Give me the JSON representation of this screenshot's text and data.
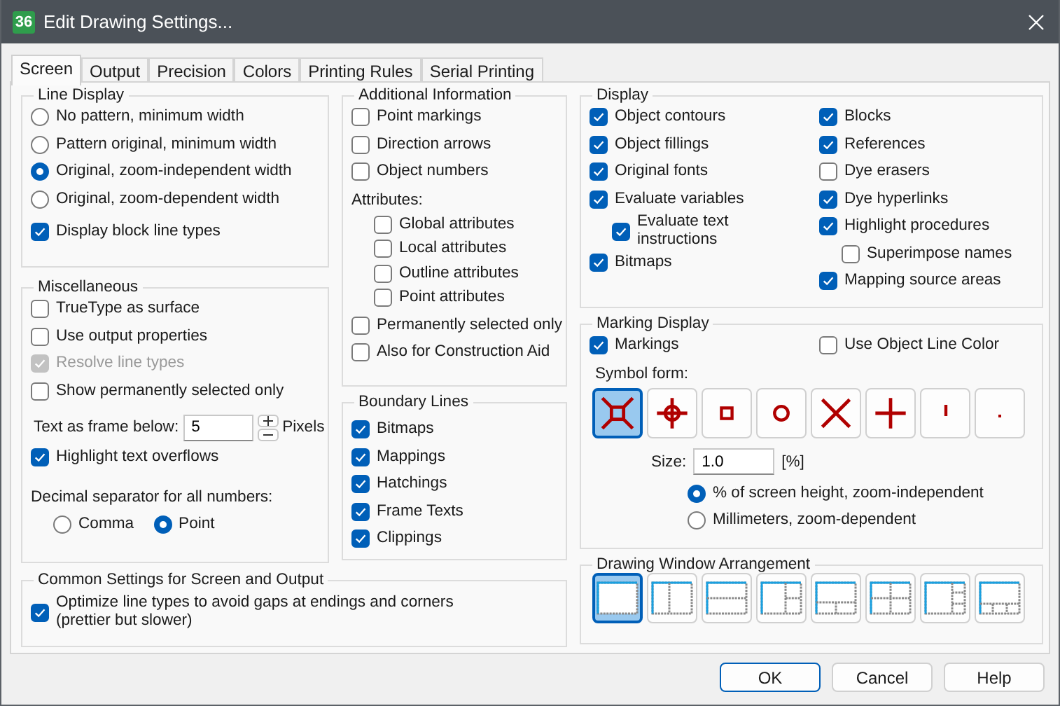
{
  "window": {
    "title": "Edit Drawing Settings...",
    "app_icon": "36"
  },
  "tabs": [
    {
      "label": "Screen",
      "selected": true
    },
    {
      "label": "Output",
      "selected": false
    },
    {
      "label": "Precision",
      "selected": false
    },
    {
      "label": "Colors",
      "selected": false
    },
    {
      "label": "Printing Rules",
      "selected": false
    },
    {
      "label": "Serial Printing",
      "selected": false
    }
  ],
  "line_display": {
    "title": "Line Display",
    "options": [
      {
        "label": "No pattern, minimum width",
        "selected": false
      },
      {
        "label": "Pattern original, minimum width",
        "selected": false
      },
      {
        "label": "Original, zoom-independent width",
        "selected": true
      },
      {
        "label": "Original, zoom-dependent width",
        "selected": false
      }
    ],
    "checkbox": {
      "label": "Display block line types",
      "checked": true
    }
  },
  "miscellaneous": {
    "title": "Miscellaneous",
    "checkboxes": [
      {
        "label": "TrueType as surface",
        "checked": false,
        "disabled": false
      },
      {
        "label": "Use output properties",
        "checked": false,
        "disabled": false
      },
      {
        "label": "Resolve line types",
        "checked": true,
        "disabled": true
      },
      {
        "label": "Show permanently selected only",
        "checked": false,
        "disabled": false
      }
    ],
    "text_frame": {
      "label": "Text as frame below:",
      "value": "5",
      "unit": "Pixels"
    },
    "highlight": {
      "label": "Highlight text overflows",
      "checked": true
    },
    "decimal": {
      "label": "Decimal separator for all numbers:",
      "options": [
        {
          "label": "Comma",
          "selected": false
        },
        {
          "label": "Point",
          "selected": true
        }
      ]
    }
  },
  "additional_information": {
    "title": "Additional Information",
    "items": [
      {
        "label": "Point markings",
        "checked": false
      },
      {
        "label": "Direction arrows",
        "checked": false
      },
      {
        "label": "Object numbers",
        "checked": false
      }
    ],
    "attributes_label": "Attributes:",
    "attributes": [
      {
        "label": "Global attributes",
        "checked": false
      },
      {
        "label": "Local attributes",
        "checked": false
      },
      {
        "label": "Outline attributes",
        "checked": false
      },
      {
        "label": "Point attributes",
        "checked": false
      }
    ],
    "more": [
      {
        "label": "Permanently selected only",
        "checked": false
      },
      {
        "label": "Also for Construction Aid",
        "checked": false
      }
    ]
  },
  "boundary_lines": {
    "title": "Boundary Lines",
    "items": [
      {
        "label": "Bitmaps",
        "checked": true
      },
      {
        "label": "Mappings",
        "checked": true
      },
      {
        "label": "Hatchings",
        "checked": true
      },
      {
        "label": "Frame Texts",
        "checked": true
      },
      {
        "label": "Clippings",
        "checked": true
      }
    ]
  },
  "common_settings": {
    "title": "Common Settings for Screen and Output",
    "items": [
      {
        "label": "Optimize line types to avoid gaps at endings and corners\n(prettier but slower)",
        "checked": true
      }
    ]
  },
  "display": {
    "title": "Display",
    "left": [
      {
        "label": "Object contours",
        "checked": true
      },
      {
        "label": "Object fillings",
        "checked": true
      },
      {
        "label": "Original fonts",
        "checked": true
      },
      {
        "label": "Evaluate variables",
        "checked": true,
        "children": [
          {
            "label": "Evaluate text\ninstructions",
            "checked": true
          }
        ]
      },
      {
        "label": "Bitmaps",
        "checked": true
      }
    ],
    "right": [
      {
        "label": "Blocks",
        "checked": true
      },
      {
        "label": "References",
        "checked": true
      },
      {
        "label": "Dye erasers",
        "checked": false
      },
      {
        "label": "Dye hyperlinks",
        "checked": true
      },
      {
        "label": "Highlight procedures",
        "checked": true,
        "children": [
          {
            "label": "Superimpose names",
            "checked": false
          }
        ]
      },
      {
        "label": "Mapping source areas",
        "checked": true
      }
    ]
  },
  "marking_display": {
    "title": "Marking Display",
    "markings": {
      "label": "Markings",
      "checked": true
    },
    "object_color": {
      "label": "Use Object Line Color",
      "checked": false
    },
    "symbol_label": "Symbol form:",
    "symbols": [
      {
        "kind": "crossbox",
        "selected": true
      },
      {
        "kind": "crosshair",
        "selected": false
      },
      {
        "kind": "square",
        "selected": false
      },
      {
        "kind": "circle",
        "selected": false
      },
      {
        "kind": "cross",
        "selected": false
      },
      {
        "kind": "plus",
        "selected": false
      },
      {
        "kind": "tick",
        "selected": false
      },
      {
        "kind": "dot",
        "selected": false
      }
    ],
    "size": {
      "label": "Size:",
      "value": "1.0",
      "unit": "[%]"
    },
    "units": [
      {
        "label": "% of screen height, zoom-independent",
        "selected": true
      },
      {
        "label": "Millimeters, zoom-dependent",
        "selected": false
      }
    ]
  },
  "arrangement": {
    "title": "Drawing Window Arrangement",
    "layouts": [
      {
        "kind": "single",
        "selected": true
      },
      {
        "kind": "columns",
        "selected": false
      },
      {
        "kind": "rows",
        "selected": false
      },
      {
        "kind": "left-main-2",
        "selected": false
      },
      {
        "kind": "top-main-2",
        "selected": false
      },
      {
        "kind": "quad",
        "selected": false
      },
      {
        "kind": "left-main-3",
        "selected": false
      },
      {
        "kind": "top-main-3",
        "selected": false
      }
    ]
  },
  "buttons": [
    {
      "label": "OK",
      "default": true
    },
    {
      "label": "Cancel",
      "default": false
    },
    {
      "label": "Help",
      "default": false
    }
  ]
}
